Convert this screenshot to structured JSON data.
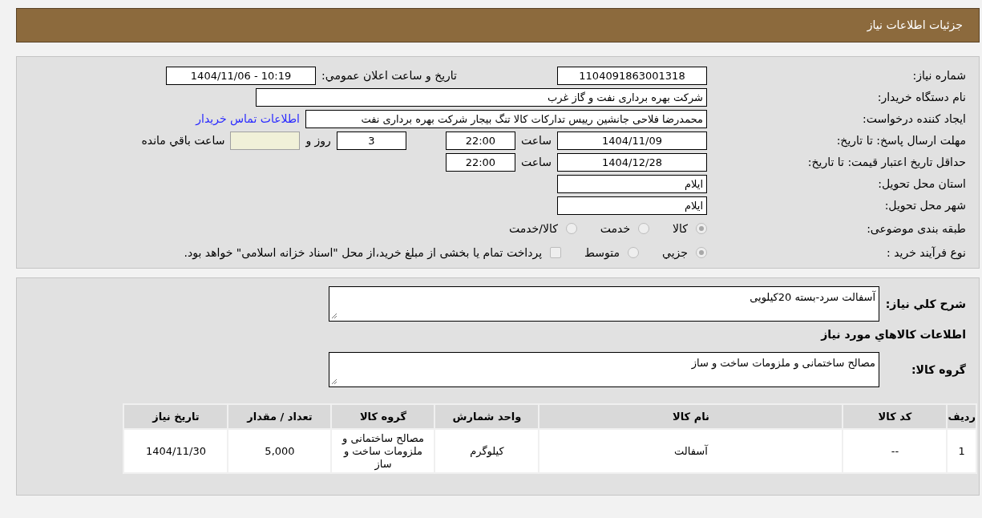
{
  "header": {
    "title": "جزئیات اطلاعات نیاز"
  },
  "details": [
    {
      "label": "شماره نیاز:",
      "items": [
        {
          "kind": "field",
          "value": "1104091863001318"
        },
        {
          "kind": "caption",
          "text": "تاریخ و ساعت اعلان عمومي:"
        },
        {
          "kind": "field",
          "value": "1404/11/06 - 10:19"
        }
      ]
    },
    {
      "label": "نام دستگاه خریدار:",
      "items": [
        {
          "kind": "long_field",
          "value": "شرکت بهره برداری نفت و گاز غرب"
        }
      ]
    },
    {
      "label": "ایجاد کننده درخواست:",
      "items": [
        {
          "kind": "wide_field",
          "value": "محمدرضا فلاحی جانشین رییس تدارکات کالا تنگ بیجار شرکت بهره برداری نفت"
        },
        {
          "kind": "link",
          "text": "اطلاعات تماس خریدار"
        }
      ]
    },
    {
      "label": "مهلت ارسال پاسخ: تا تاریخ:",
      "items": [
        {
          "kind": "field",
          "value": "1404/11/09"
        },
        {
          "kind": "unit",
          "text": "ساعت"
        },
        {
          "kind": "short_field",
          "value": "22:00"
        },
        {
          "kind": "count_field",
          "value": "3"
        },
        {
          "kind": "unit",
          "text": "روز و"
        },
        {
          "kind": "remaining_field"
        },
        {
          "kind": "unit",
          "text": "ساعت باقي مانده"
        }
      ]
    },
    {
      "label": "حداقل تاریخ اعتبار قیمت: تا تاریخ:",
      "items": [
        {
          "kind": "field",
          "value": "1404/12/28"
        },
        {
          "kind": "unit",
          "text": "ساعت"
        },
        {
          "kind": "short_field",
          "value": "22:00"
        }
      ]
    },
    {
      "label": "استان محل تحویل:",
      "items": [
        {
          "kind": "text_field",
          "value": "ایلام"
        }
      ]
    },
    {
      "label": "شهر محل تحویل:",
      "items": [
        {
          "kind": "text_field",
          "value": "ایلام"
        }
      ]
    },
    {
      "label": "طبقه بندی موضوعی:",
      "items": [
        {
          "kind": "radio",
          "text": "کالا",
          "selected": true
        },
        {
          "kind": "radio",
          "text": "خدمت",
          "selected": false
        },
        {
          "kind": "radio",
          "text": "کالا/خدمت",
          "selected": false
        }
      ]
    },
    {
      "label": "نوع فرآیند خرید :",
      "items": [
        {
          "kind": "radio",
          "text": "جزيي",
          "selected": true
        },
        {
          "kind": "radio",
          "text": "متوسط",
          "selected": false
        },
        {
          "kind": "checkbox",
          "text": "پرداخت تمام یا بخشی از مبلغ خرید،از محل \"اسناد خزانه اسلامی\" خواهد بود.",
          "checked": false
        }
      ]
    }
  ],
  "description": {
    "label": "شرح کلي نیاز:",
    "value": "آسفالت سرد-بسته 20کیلویی"
  },
  "goods_title": "اطلاعات کالاهاي مورد نیاز",
  "goods_group": {
    "label": "گروه کالا:",
    "value": "مصالح ساختمانی و ملزومات ساخت و ساز"
  },
  "table": {
    "columns": [
      "ردیف",
      "کد کالا",
      "نام کالا",
      "واحد شمارش",
      "گروه کالا",
      "تعداد / مقدار",
      "تاریخ نیاز"
    ],
    "rows": [
      [
        "1",
        "--",
        "آسفالت",
        "کیلوگرم",
        "مصالح ساختمانی و ملزومات ساخت و ساز",
        "5,000",
        "1404/11/30"
      ]
    ]
  }
}
